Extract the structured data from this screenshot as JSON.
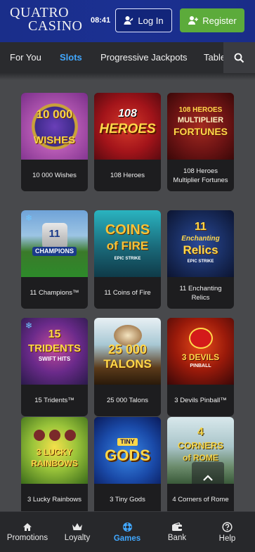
{
  "header": {
    "logo_line1": "QUATRO",
    "logo_line2": "CASINO",
    "time": "08:41",
    "login_label": "Log In",
    "register_label": "Register"
  },
  "tabs": [
    {
      "label": "For You",
      "active": false
    },
    {
      "label": "Slots",
      "active": true
    },
    {
      "label": "Progressive Jackpots",
      "active": false
    },
    {
      "label": "Table",
      "active": false
    }
  ],
  "games": [
    {
      "title": "10 000 Wishes",
      "logo": "10 000\nWISHES"
    },
    {
      "title": "108 Heroes",
      "logo": "108\nHEROES"
    },
    {
      "title": "108 Heroes Multiplier Fortunes",
      "logo": "108 HEROES\nMULTIPLIER\nFORTUNES"
    },
    {
      "title": "11 Champions™",
      "logo": "11\nCHAMPIONS"
    },
    {
      "title": "11 Coins of Fire",
      "logo": "11\nCOINS\nOF FIRE"
    },
    {
      "title": "11 Enchanting Relics",
      "logo": "11\nEnchanting\nRelics"
    },
    {
      "title": "15 Tridents™",
      "logo": "15\nTRIDENTS\nSWIFT HITS"
    },
    {
      "title": "25 000 Talons",
      "logo": "25 000\nTALONS"
    },
    {
      "title": "3 Devils Pinball™",
      "logo": "3 DEVILS\nPINBALL"
    },
    {
      "title": "3 Lucky Rainbows",
      "logo": "3 LUCKY\nRAINBOWS"
    },
    {
      "title": "3 Tiny Gods",
      "logo": "TINY\nGODS"
    },
    {
      "title": "4 Corners of Rome",
      "logo": "4\nCORNERS\nof ROME"
    }
  ],
  "bottom_nav": [
    {
      "label": "Promotions",
      "icon": "home-icon"
    },
    {
      "label": "Loyalty",
      "icon": "crown-icon"
    },
    {
      "label": "Games",
      "icon": "games-icon",
      "active": true
    },
    {
      "label": "Bank",
      "icon": "wallet-icon"
    },
    {
      "label": "Help",
      "icon": "help-icon"
    }
  ],
  "colors": {
    "header_bg": "#1b3092",
    "register_green": "#5cab3b",
    "active_blue": "#41a8ff",
    "page_bg": "#48494c"
  }
}
